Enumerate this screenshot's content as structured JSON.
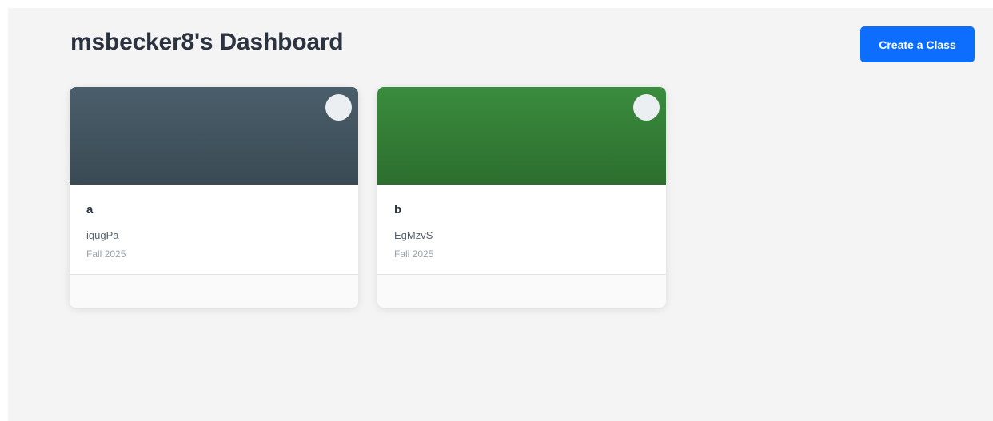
{
  "header": {
    "title": "msbecker8's Dashboard",
    "create_button_label": "Create a Class"
  },
  "classes": [
    {
      "name": "a",
      "code": "iqugPa",
      "term": "Fall 2025",
      "banner_color": "#445865"
    },
    {
      "name": "b",
      "code": "EgMzvS",
      "term": "Fall 2025",
      "banner_color": "#347e36"
    }
  ],
  "colors": {
    "accent": "#0d6efd",
    "background": "#f4f4f4"
  }
}
